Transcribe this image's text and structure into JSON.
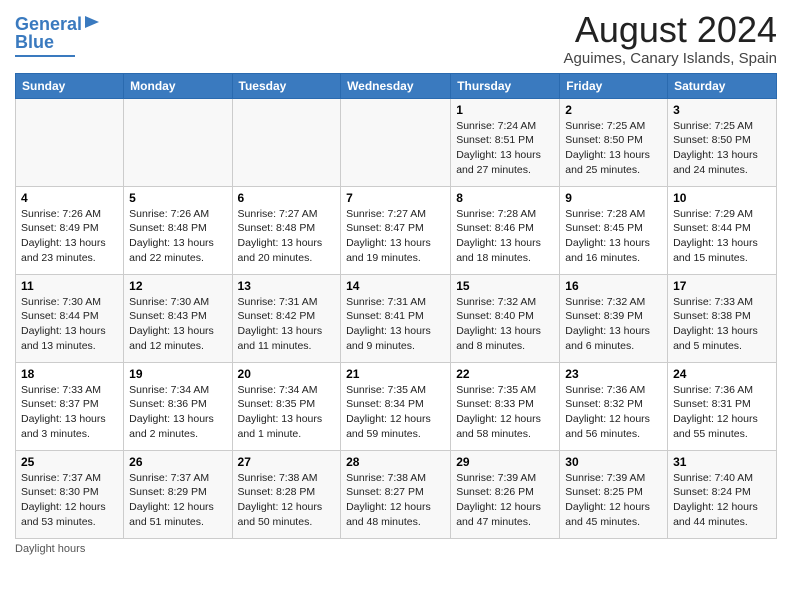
{
  "header": {
    "logo_line1": "General",
    "logo_line2": "Blue",
    "main_title": "August 2024",
    "subtitle": "Aguimes, Canary Islands, Spain"
  },
  "days_of_week": [
    "Sunday",
    "Monday",
    "Tuesday",
    "Wednesday",
    "Thursday",
    "Friday",
    "Saturday"
  ],
  "weeks": [
    [
      {
        "day": "",
        "info": ""
      },
      {
        "day": "",
        "info": ""
      },
      {
        "day": "",
        "info": ""
      },
      {
        "day": "",
        "info": ""
      },
      {
        "day": "1",
        "info": "Sunrise: 7:24 AM\nSunset: 8:51 PM\nDaylight: 13 hours and 27 minutes."
      },
      {
        "day": "2",
        "info": "Sunrise: 7:25 AM\nSunset: 8:50 PM\nDaylight: 13 hours and 25 minutes."
      },
      {
        "day": "3",
        "info": "Sunrise: 7:25 AM\nSunset: 8:50 PM\nDaylight: 13 hours and 24 minutes."
      }
    ],
    [
      {
        "day": "4",
        "info": "Sunrise: 7:26 AM\nSunset: 8:49 PM\nDaylight: 13 hours and 23 minutes."
      },
      {
        "day": "5",
        "info": "Sunrise: 7:26 AM\nSunset: 8:48 PM\nDaylight: 13 hours and 22 minutes."
      },
      {
        "day": "6",
        "info": "Sunrise: 7:27 AM\nSunset: 8:48 PM\nDaylight: 13 hours and 20 minutes."
      },
      {
        "day": "7",
        "info": "Sunrise: 7:27 AM\nSunset: 8:47 PM\nDaylight: 13 hours and 19 minutes."
      },
      {
        "day": "8",
        "info": "Sunrise: 7:28 AM\nSunset: 8:46 PM\nDaylight: 13 hours and 18 minutes."
      },
      {
        "day": "9",
        "info": "Sunrise: 7:28 AM\nSunset: 8:45 PM\nDaylight: 13 hours and 16 minutes."
      },
      {
        "day": "10",
        "info": "Sunrise: 7:29 AM\nSunset: 8:44 PM\nDaylight: 13 hours and 15 minutes."
      }
    ],
    [
      {
        "day": "11",
        "info": "Sunrise: 7:30 AM\nSunset: 8:44 PM\nDaylight: 13 hours and 13 minutes."
      },
      {
        "day": "12",
        "info": "Sunrise: 7:30 AM\nSunset: 8:43 PM\nDaylight: 13 hours and 12 minutes."
      },
      {
        "day": "13",
        "info": "Sunrise: 7:31 AM\nSunset: 8:42 PM\nDaylight: 13 hours and 11 minutes."
      },
      {
        "day": "14",
        "info": "Sunrise: 7:31 AM\nSunset: 8:41 PM\nDaylight: 13 hours and 9 minutes."
      },
      {
        "day": "15",
        "info": "Sunrise: 7:32 AM\nSunset: 8:40 PM\nDaylight: 13 hours and 8 minutes."
      },
      {
        "day": "16",
        "info": "Sunrise: 7:32 AM\nSunset: 8:39 PM\nDaylight: 13 hours and 6 minutes."
      },
      {
        "day": "17",
        "info": "Sunrise: 7:33 AM\nSunset: 8:38 PM\nDaylight: 13 hours and 5 minutes."
      }
    ],
    [
      {
        "day": "18",
        "info": "Sunrise: 7:33 AM\nSunset: 8:37 PM\nDaylight: 13 hours and 3 minutes."
      },
      {
        "day": "19",
        "info": "Sunrise: 7:34 AM\nSunset: 8:36 PM\nDaylight: 13 hours and 2 minutes."
      },
      {
        "day": "20",
        "info": "Sunrise: 7:34 AM\nSunset: 8:35 PM\nDaylight: 13 hours and 1 minute."
      },
      {
        "day": "21",
        "info": "Sunrise: 7:35 AM\nSunset: 8:34 PM\nDaylight: 12 hours and 59 minutes."
      },
      {
        "day": "22",
        "info": "Sunrise: 7:35 AM\nSunset: 8:33 PM\nDaylight: 12 hours and 58 minutes."
      },
      {
        "day": "23",
        "info": "Sunrise: 7:36 AM\nSunset: 8:32 PM\nDaylight: 12 hours and 56 minutes."
      },
      {
        "day": "24",
        "info": "Sunrise: 7:36 AM\nSunset: 8:31 PM\nDaylight: 12 hours and 55 minutes."
      }
    ],
    [
      {
        "day": "25",
        "info": "Sunrise: 7:37 AM\nSunset: 8:30 PM\nDaylight: 12 hours and 53 minutes."
      },
      {
        "day": "26",
        "info": "Sunrise: 7:37 AM\nSunset: 8:29 PM\nDaylight: 12 hours and 51 minutes."
      },
      {
        "day": "27",
        "info": "Sunrise: 7:38 AM\nSunset: 8:28 PM\nDaylight: 12 hours and 50 minutes."
      },
      {
        "day": "28",
        "info": "Sunrise: 7:38 AM\nSunset: 8:27 PM\nDaylight: 12 hours and 48 minutes."
      },
      {
        "day": "29",
        "info": "Sunrise: 7:39 AM\nSunset: 8:26 PM\nDaylight: 12 hours and 47 minutes."
      },
      {
        "day": "30",
        "info": "Sunrise: 7:39 AM\nSunset: 8:25 PM\nDaylight: 12 hours and 45 minutes."
      },
      {
        "day": "31",
        "info": "Sunrise: 7:40 AM\nSunset: 8:24 PM\nDaylight: 12 hours and 44 minutes."
      }
    ]
  ],
  "footer": {
    "note": "Daylight hours"
  }
}
